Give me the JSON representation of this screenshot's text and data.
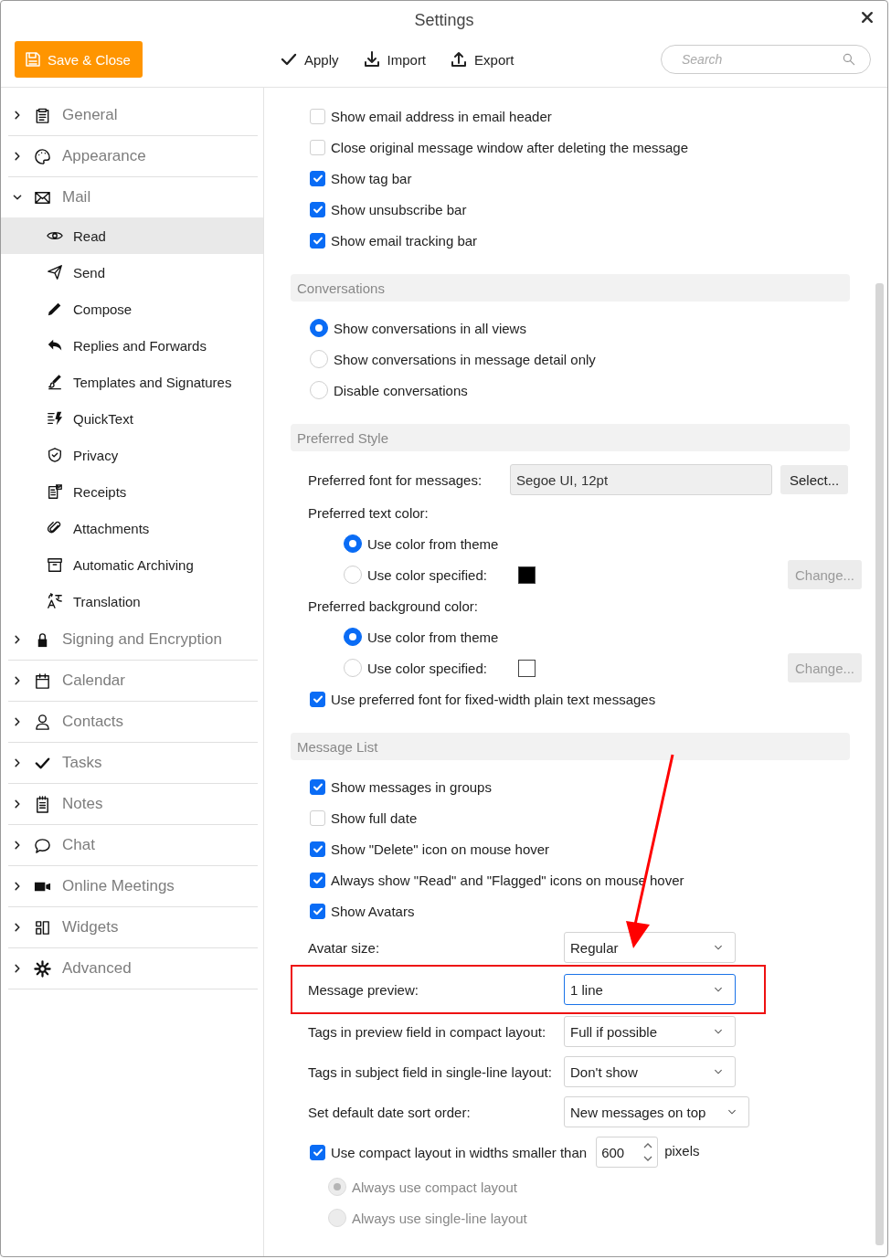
{
  "window": {
    "title": "Settings"
  },
  "toolbar": {
    "save_button": "Save & Close",
    "actions": [
      {
        "kind": "apply",
        "label": "Apply"
      },
      {
        "kind": "import",
        "label": "Import"
      },
      {
        "kind": "export",
        "label": "Export"
      }
    ],
    "search": {
      "placeholder": "Search"
    }
  },
  "sidebar": {
    "items": [
      {
        "kind": "clipboard",
        "label": "General",
        "expanded": false
      },
      {
        "kind": "palette",
        "label": "Appearance",
        "expanded": false
      },
      {
        "kind": "envelope",
        "label": "Mail",
        "expanded": true,
        "children": [
          {
            "kind": "eye",
            "label": "Read",
            "selected": true
          },
          {
            "kind": "send",
            "label": "Send",
            "selected": false
          },
          {
            "kind": "pencil",
            "label": "Compose",
            "selected": false
          },
          {
            "kind": "reply",
            "label": "Replies and Forwards",
            "selected": false
          },
          {
            "kind": "brush",
            "label": "Templates and Signatures",
            "selected": false
          },
          {
            "kind": "quicktext",
            "label": "QuickText",
            "selected": false
          },
          {
            "kind": "shield",
            "label": "Privacy",
            "selected": false
          },
          {
            "kind": "receipt",
            "label": "Receipts",
            "selected": false
          },
          {
            "kind": "paperclip",
            "label": "Attachments",
            "selected": false
          },
          {
            "kind": "archive",
            "label": "Automatic Archiving",
            "selected": false
          },
          {
            "kind": "translate",
            "label": "Translation",
            "selected": false
          }
        ]
      },
      {
        "kind": "lock",
        "label": "Signing and Encryption",
        "expanded": false
      },
      {
        "kind": "calendar",
        "label": "Calendar",
        "expanded": false
      },
      {
        "kind": "person",
        "label": "Contacts",
        "expanded": false
      },
      {
        "kind": "check",
        "label": "Tasks",
        "expanded": false
      },
      {
        "kind": "notepad",
        "label": "Notes",
        "expanded": false
      },
      {
        "kind": "chat",
        "label": "Chat",
        "expanded": false
      },
      {
        "kind": "video",
        "label": "Online Meetings",
        "expanded": false
      },
      {
        "kind": "widgets",
        "label": "Widgets",
        "expanded": false
      },
      {
        "kind": "gear",
        "label": "Advanced",
        "expanded": false
      }
    ]
  },
  "content": {
    "items": [
      {
        "kind": "checkbox",
        "label": "Show email address in email header",
        "checked": false
      },
      {
        "kind": "checkbox",
        "label": "Close original message window after deleting the message",
        "checked": false
      },
      {
        "kind": "checkbox",
        "label": "Show tag bar",
        "checked": true
      },
      {
        "kind": "checkbox",
        "label": "Show unsubscribe bar",
        "checked": true
      },
      {
        "kind": "checkbox",
        "label": "Show email tracking bar",
        "checked": true
      },
      {
        "kind": "section",
        "label": "Conversations"
      },
      {
        "kind": "radio",
        "label": "Show conversations in all views",
        "selected": true
      },
      {
        "kind": "radio",
        "label": "Show conversations in message detail only",
        "selected": false
      },
      {
        "kind": "radio",
        "label": "Disable conversations",
        "selected": false
      },
      {
        "kind": "section",
        "label": "Preferred Style"
      },
      {
        "kind": "font",
        "label": "Preferred font for messages:",
        "value": "Segoe UI, 12pt",
        "button": "Select..."
      },
      {
        "kind": "label",
        "label": "Preferred text color:"
      },
      {
        "kind": "subradio",
        "label": "Use color from theme",
        "selected": true
      },
      {
        "kind": "color_radio",
        "label": "Use color specified:",
        "selected": false,
        "color": "#000000",
        "button": {
          "label": "Change...",
          "disabled": true
        }
      },
      {
        "kind": "label",
        "label": "Preferred background color:"
      },
      {
        "kind": "subradio",
        "label": "Use color from theme",
        "selected": true
      },
      {
        "kind": "color_radio",
        "label": "Use color specified:",
        "selected": false,
        "color": "#ffffff",
        "button": {
          "label": "Change...",
          "disabled": true
        }
      },
      {
        "kind": "checkbox",
        "label": "Use preferred font for fixed-width plain text messages",
        "checked": true
      },
      {
        "kind": "section",
        "label": "Message List"
      },
      {
        "kind": "checkbox",
        "label": "Show messages in groups",
        "checked": true
      },
      {
        "kind": "checkbox",
        "label": "Show full date",
        "checked": false
      },
      {
        "kind": "checkbox",
        "label": "Show \"Delete\" icon on mouse hover",
        "checked": true
      },
      {
        "kind": "checkbox",
        "label": "Always show \"Read\" and \"Flagged\" icons on mouse hover",
        "checked": true
      },
      {
        "kind": "checkbox",
        "label": "Show Avatars",
        "checked": true
      },
      {
        "kind": "select",
        "label": "Avatar size:",
        "value": "Regular",
        "focused": false,
        "highlighted": false
      },
      {
        "kind": "select",
        "label": "Message preview:",
        "value": "1 line",
        "focused": true,
        "highlighted": true
      },
      {
        "kind": "select",
        "label": "Tags in preview field in compact layout:",
        "value": "Full if possible",
        "focused": false,
        "highlighted": false
      },
      {
        "kind": "select",
        "label": "Tags in subject field in single-line layout:",
        "value": "Don't show",
        "focused": false,
        "highlighted": false
      },
      {
        "kind": "select",
        "label": "Set default date sort order:",
        "value": "New messages on top",
        "focused": false,
        "highlighted": false,
        "wide": true
      },
      {
        "kind": "number",
        "label": "Use compact layout in widths smaller than",
        "checked": true,
        "value": "600",
        "unit": "pixels",
        "children": [
          {
            "label": "Always use compact layout",
            "selected": true,
            "disabled": true
          },
          {
            "label": "Always use single-line layout",
            "selected": false,
            "disabled": true
          }
        ]
      }
    ]
  }
}
